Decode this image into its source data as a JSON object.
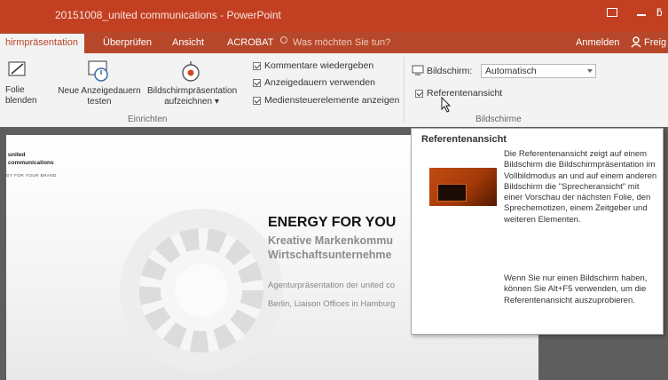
{
  "window": {
    "title": "20151008_united communications - PowerPoint",
    "extra_glyph": "ƃ"
  },
  "tabs": {
    "active": "hirmpräsentation",
    "items": [
      "Überprüfen",
      "Ansicht",
      "ACROBAT"
    ],
    "tell_me": "Was möchten Sie tun?",
    "sign_in": "Anmelden",
    "share": "Freig"
  },
  "ribbon": {
    "folie_line1": "Folie",
    "folie_line2": "blenden",
    "neue_line1": "Neue Anzeigedauern",
    "neue_line2": "testen",
    "aufz_line1": "Bildschirmpräsentation",
    "aufz_line2": "aufzeichnen ▾",
    "group_einrichten": "Einrichten",
    "checkboxes": [
      "Kommentare wiedergeben",
      "Anzeigedauern verwenden",
      "Mediensteuerelemente anzeigen"
    ],
    "bildschirm_label": "Bildschirm:",
    "bildschirm_value": "Automatisch",
    "referenten_label": "Referentenansicht",
    "group_bildschirme": "Bildschirme"
  },
  "slide": {
    "logo_line1": "united",
    "logo_line2": "communications",
    "logo_tagline": "GY FOR YOUR BRAND",
    "headline": "ENERGY FOR YOU",
    "subhead1": "Kreative Markenkommu",
    "subhead2": "Wirtschaftsunternehme",
    "agentur": "Agenturpräsentation der united co",
    "berlin": "Berlin, Liaison Offices in Hamburg"
  },
  "tooltip": {
    "title": "Referentenansicht",
    "text1": "Die Referentenansicht zeigt auf einem Bildschirm die Bildschirmpräsentation im Vollbildmodus an und auf einem anderen Bildschirm die \"Sprecheransicht\" mit einer Vorschau der nächsten Folie, den Sprechernotizen, einem Zeitgeber und weiteren Elementen.",
    "text2": "Wenn Sie nur einen Bildschirm haben, können Sie Alt+F5 verwenden, um die Referentenansicht auszuprobieren."
  },
  "colors": {
    "title_bar": "#c33f22",
    "tab_bar": "#b7472a",
    "ribbon": "#f3f3f3",
    "workspace": "#5e5e5e"
  },
  "icons": [
    "hide-slide-icon",
    "rehearse-timings-icon",
    "record-slideshow-icon",
    "monitor-icon",
    "lightbulb-icon",
    "person-icon",
    "restore-icon",
    "minimize-icon",
    "mouse-cursor-icon"
  ]
}
